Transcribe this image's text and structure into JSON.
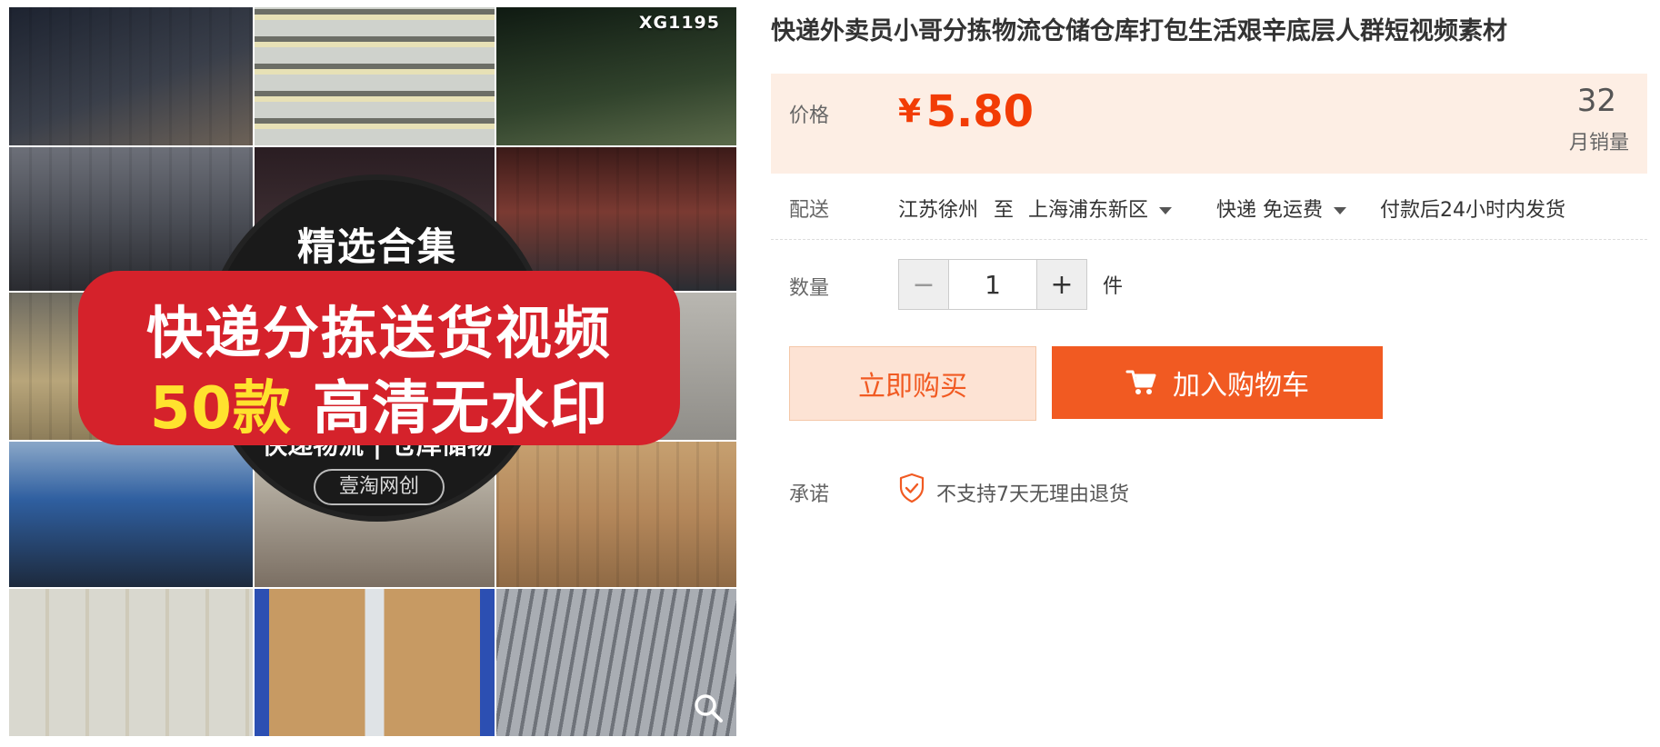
{
  "gallery": {
    "code_badge": "XG1195",
    "circle_title": "精选合集",
    "banner_line1": "快递分拣送货视频",
    "banner_line2_highlight": "50款",
    "banner_line2_rest": "高清无水印",
    "circle_subtitle": "快递物流 | 仓库储物",
    "circle_shop": "壹淘网创",
    "zoom_icon": "magnifier-icon"
  },
  "product": {
    "title": "快递外卖员小哥分拣物流仓储仓库打包生活艰辛底层人群短视频素材"
  },
  "price": {
    "label": "价格",
    "currency": "¥",
    "value": "5.80",
    "sales_count": "32",
    "sales_label": "月销量",
    "color": "#f23c05"
  },
  "shipping": {
    "label": "配送",
    "from": "江苏徐州",
    "to_word": "至",
    "destination": "上海浦东新区",
    "method": "快递 免运费",
    "dispatch": "付款后24小时内发货"
  },
  "quantity": {
    "label": "数量",
    "minus": "−",
    "plus": "+",
    "value": "1",
    "unit": "件"
  },
  "actions": {
    "buy_now": "立即购买",
    "add_to_cart": "加入购物车",
    "cart_icon": "shopping-cart-icon",
    "accent": "#f15a22"
  },
  "promise": {
    "label": "承诺",
    "text": "不支持7天无理由退货",
    "icon": "shield-check-icon"
  }
}
